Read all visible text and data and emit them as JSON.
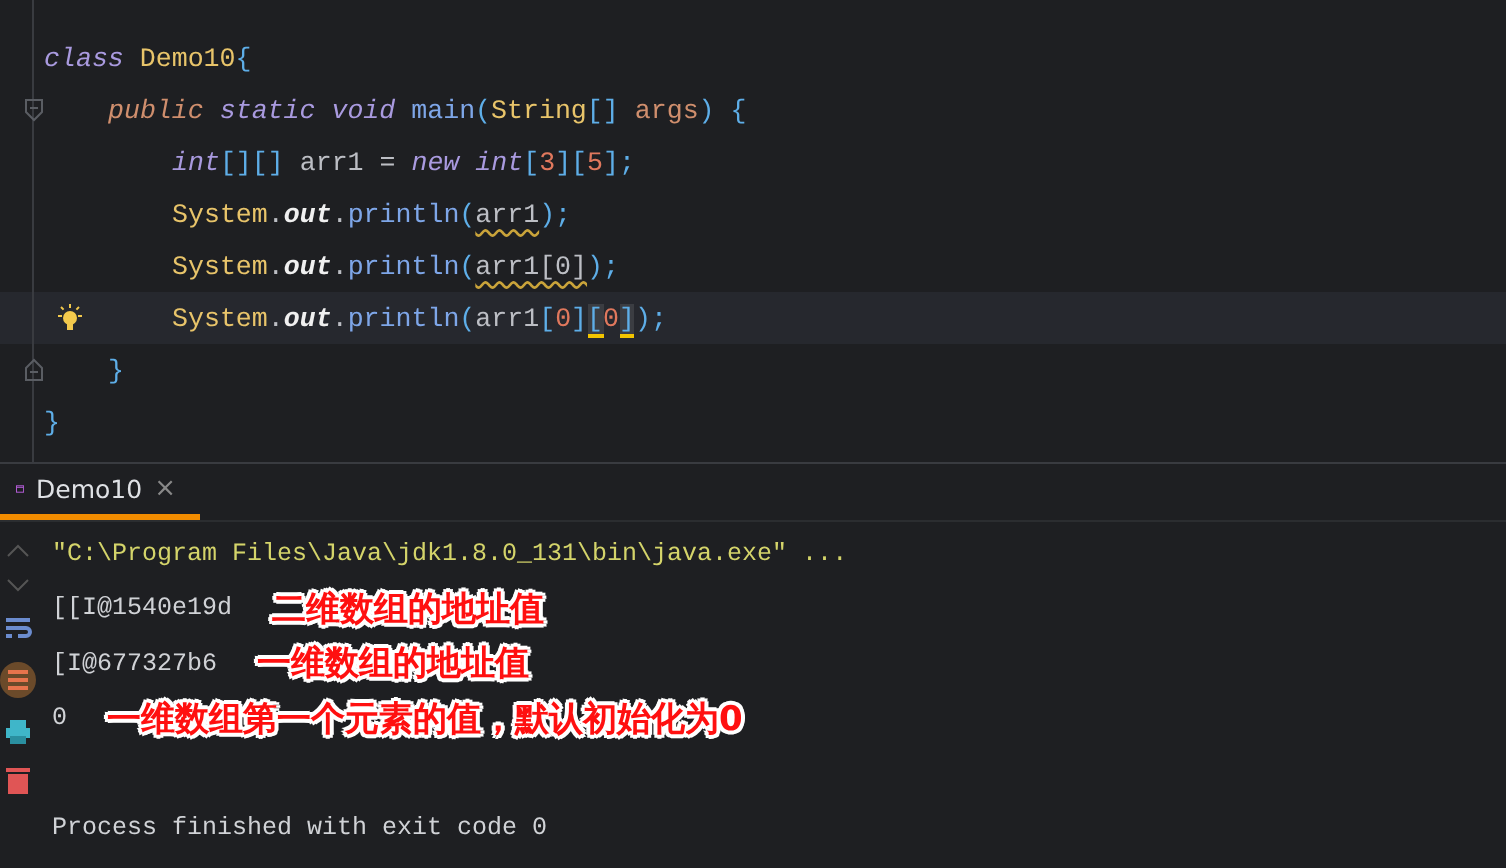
{
  "editor": {
    "lines": [
      {
        "current": false,
        "bulb": false,
        "tokens": [
          {
            "text": "class ",
            "kind": "keyword"
          },
          {
            "text": "Demo10",
            "kind": "class"
          },
          {
            "text": "{",
            "kind": "brace"
          }
        ],
        "children": [
          {
            "current": false,
            "bulb": false,
            "fold_start": true,
            "tokens": [
              {
                "text": "public ",
                "kind": "modifier"
              },
              {
                "text": "static ",
                "kind": "keyword"
              },
              {
                "text": "void ",
                "kind": "keyword"
              },
              {
                "text": "main",
                "kind": "method"
              },
              {
                "text": "(",
                "kind": "brace"
              },
              {
                "text": "String",
                "kind": "class"
              },
              {
                "text": "[] ",
                "kind": "brace"
              },
              {
                "text": "args",
                "kind": "param"
              },
              {
                "text": ") {",
                "kind": "brace"
              }
            ],
            "children": [
              {
                "current": false,
                "bulb": false,
                "tokens": [
                  {
                    "text": "int",
                    "kind": "keyword"
                  },
                  {
                    "text": "[][]",
                    "kind": "brace"
                  },
                  {
                    "text": " arr1 = ",
                    "kind": "plain"
                  },
                  {
                    "text": "new ",
                    "kind": "keyword"
                  },
                  {
                    "text": "int",
                    "kind": "keyword"
                  },
                  {
                    "text": "[",
                    "kind": "brace"
                  },
                  {
                    "text": "3",
                    "kind": "number"
                  },
                  {
                    "text": "][",
                    "kind": "brace"
                  },
                  {
                    "text": "5",
                    "kind": "number"
                  },
                  {
                    "text": "];",
                    "kind": "brace"
                  }
                ]
              },
              {
                "current": false,
                "bulb": false,
                "tokens": [
                  {
                    "text": "System",
                    "kind": "class"
                  },
                  {
                    "text": ".",
                    "kind": "plain"
                  },
                  {
                    "text": "out",
                    "kind": "field"
                  },
                  {
                    "text": ".",
                    "kind": "plain"
                  },
                  {
                    "text": "println",
                    "kind": "method"
                  },
                  {
                    "text": "(",
                    "kind": "brace"
                  },
                  {
                    "text": "arr1",
                    "kind": "plain",
                    "warning": true
                  },
                  {
                    "text": ");",
                    "kind": "brace"
                  }
                ]
              },
              {
                "current": false,
                "bulb": false,
                "tokens": [
                  {
                    "text": "System",
                    "kind": "class"
                  },
                  {
                    "text": ".",
                    "kind": "plain"
                  },
                  {
                    "text": "out",
                    "kind": "field"
                  },
                  {
                    "text": ".",
                    "kind": "plain"
                  },
                  {
                    "text": "println",
                    "kind": "method"
                  },
                  {
                    "text": "(",
                    "kind": "brace"
                  },
                  {
                    "text": "arr1[0]",
                    "kind": "plain",
                    "warning": true
                  },
                  {
                    "text": ");",
                    "kind": "brace"
                  }
                ]
              },
              {
                "current": true,
                "bulb": true,
                "tokens": [
                  {
                    "text": "System",
                    "kind": "class"
                  },
                  {
                    "text": ".",
                    "kind": "plain"
                  },
                  {
                    "text": "out",
                    "kind": "field"
                  },
                  {
                    "text": ".",
                    "kind": "plain"
                  },
                  {
                    "text": "println",
                    "kind": "method"
                  },
                  {
                    "text": "(",
                    "kind": "brace"
                  },
                  {
                    "text": "arr1",
                    "kind": "plain"
                  },
                  {
                    "text": "[",
                    "kind": "brace"
                  },
                  {
                    "text": "0",
                    "kind": "number"
                  },
                  {
                    "text": "]",
                    "kind": "brace"
                  },
                  {
                    "text": "[",
                    "kind": "brace",
                    "highlight": true
                  },
                  {
                    "text": "0",
                    "kind": "number"
                  },
                  {
                    "text": "]",
                    "kind": "brace",
                    "highlight": true
                  },
                  {
                    "text": ");",
                    "kind": "brace"
                  }
                ]
              }
            ]
          },
          {
            "current": false,
            "bulb": false,
            "fold_end": true,
            "tokens": [
              {
                "text": "}",
                "kind": "brace"
              }
            ]
          }
        ]
      },
      {
        "current": false,
        "bulb": false,
        "tokens": [
          {
            "text": "}",
            "kind": "brace"
          }
        ]
      }
    ]
  },
  "run_panel": {
    "tabs": [
      {
        "label": "Demo10",
        "selected": true,
        "close": "×"
      }
    ],
    "output": [
      {
        "text": "\"C:\\Program Files\\Java\\jdk1.8.0_131\\bin\\java.exe\" ...",
        "kind": "command"
      },
      {
        "text": "[[I@1540e19d",
        "kind": "output",
        "annotation": "二维数组的地址值"
      },
      {
        "text": "[I@677327b6",
        "kind": "output",
        "annotation": "一维数组的地址值"
      },
      {
        "text": "0",
        "kind": "output",
        "annotation": "一维数组第一个元素的值，默认初始化为0"
      },
      {
        "kind": "blank"
      },
      {
        "text": "Process finished with exit code 0",
        "kind": "output"
      }
    ]
  }
}
